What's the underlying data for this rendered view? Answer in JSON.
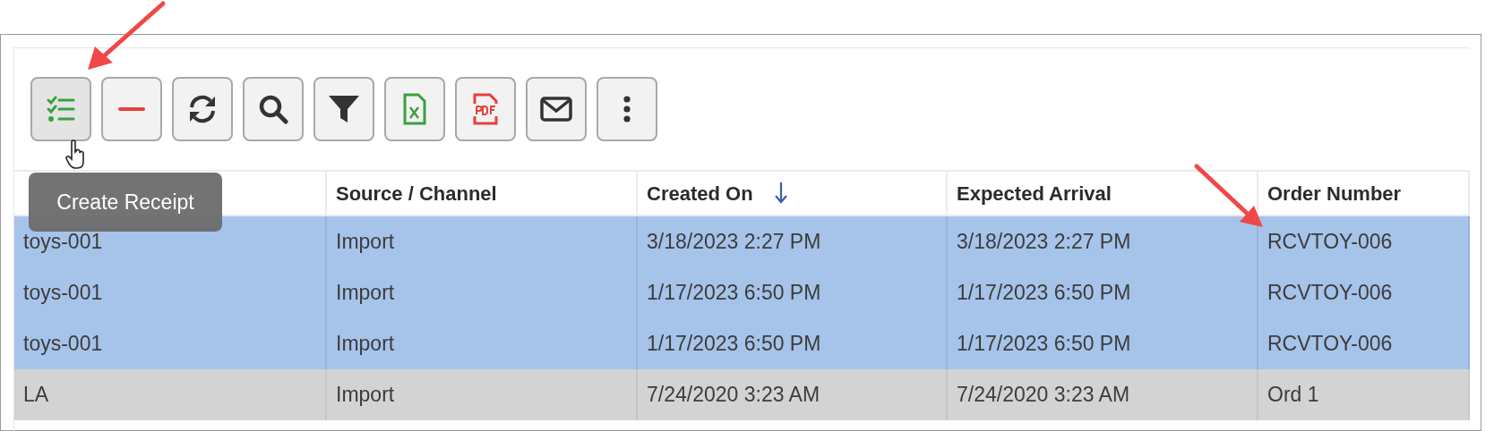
{
  "toolbar": {
    "buttons": [
      {
        "kind": "checklist",
        "hovered": true
      },
      {
        "kind": "minus",
        "hovered": false
      },
      {
        "kind": "refresh",
        "hovered": false
      },
      {
        "kind": "search",
        "hovered": false
      },
      {
        "kind": "filter",
        "hovered": false
      },
      {
        "kind": "excel",
        "hovered": false
      },
      {
        "kind": "pdf",
        "hovered": false
      },
      {
        "kind": "email",
        "hovered": false
      },
      {
        "kind": "more",
        "hovered": false
      }
    ]
  },
  "tooltip": {
    "text": "Create Receipt"
  },
  "table": {
    "columns": [
      {
        "sorted_descending": false
      },
      {
        "label": "Source / Channel",
        "sorted_descending": false
      },
      {
        "label": "Created On",
        "sorted_descending": true
      },
      {
        "label": "Expected Arrival",
        "sorted_descending": false
      },
      {
        "label": "Order Number",
        "sorted_descending": false
      }
    ],
    "rows": [
      {
        "selected": true,
        "hovered": false,
        "cells": [
          "toys-001",
          "Import",
          "3/18/2023 2:27 PM",
          "3/18/2023 2:27 PM",
          "RCVTOY-006"
        ]
      },
      {
        "selected": true,
        "hovered": false,
        "cells": [
          "toys-001",
          "Import",
          "1/17/2023 6:50 PM",
          "1/17/2023 6:50 PM",
          "RCVTOY-006"
        ]
      },
      {
        "selected": true,
        "hovered": false,
        "cells": [
          "toys-001",
          "Import",
          "1/17/2023 6:50 PM",
          "1/17/2023 6:50 PM",
          "RCVTOY-006"
        ]
      },
      {
        "selected": false,
        "hovered": true,
        "cells": [
          "LA",
          "Import",
          "7/24/2020 3:23 AM",
          "7/24/2020 3:23 AM",
          "Ord 1"
        ]
      }
    ]
  }
}
